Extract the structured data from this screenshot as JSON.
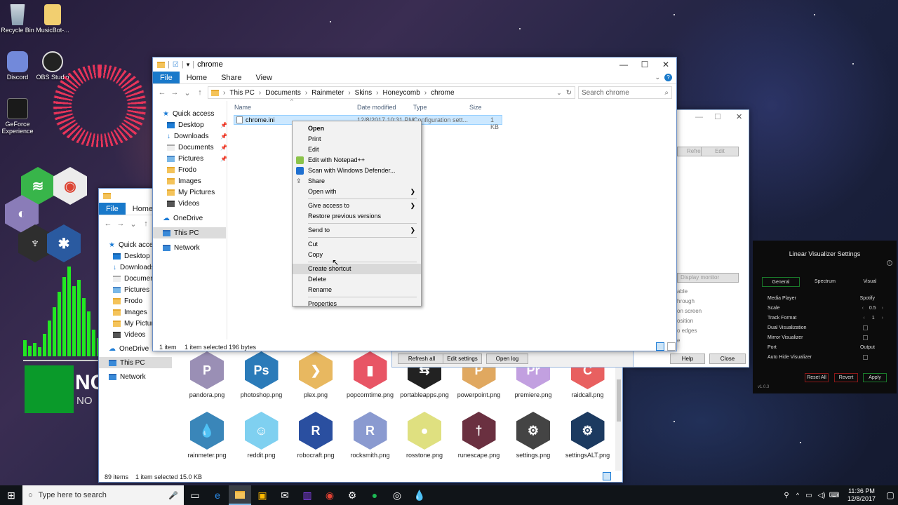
{
  "desktop": {
    "icons": [
      {
        "label": "Recycle Bin"
      },
      {
        "label": "MusicBot-..."
      },
      {
        "label": "Discord"
      },
      {
        "label": "OBS Studio"
      },
      {
        "label": "GeForce Experience"
      }
    ],
    "partial_text_large": "NO",
    "partial_text_small": "NO"
  },
  "explorer_front": {
    "title": "chrome",
    "tabs": [
      "File",
      "Home",
      "Share",
      "View"
    ],
    "breadcrumb": [
      "This PC",
      "Documents",
      "Rainmeter",
      "Skins",
      "Honeycomb",
      "chrome"
    ],
    "search_placeholder": "Search chrome",
    "nav": {
      "quick_access": "Quick access",
      "items": [
        "Desktop",
        "Downloads",
        "Documents",
        "Pictures",
        "Frodo",
        "Images",
        "My Pictures",
        "Videos"
      ],
      "onedrive": "OneDrive",
      "thispc": "This PC",
      "network": "Network"
    },
    "columns": [
      "Name",
      "Date modified",
      "Type",
      "Size"
    ],
    "file": {
      "name": "chrome.ini",
      "date": "12/8/2017 10:31 PM",
      "type": "Configuration sett...",
      "size": "1 KB"
    },
    "status": {
      "count": "1 item",
      "selected": "1 item selected  196 bytes"
    }
  },
  "context_menu": {
    "items": [
      "Open",
      "Print",
      "Edit",
      "Edit with Notepad++",
      "Scan with Windows Defender...",
      "Share",
      "Open with",
      "Give access to",
      "Restore previous versions",
      "Send to",
      "Cut",
      "Copy",
      "Create shortcut",
      "Delete",
      "Rename",
      "Properties"
    ]
  },
  "explorer_back": {
    "tabs": [
      "File",
      "Home"
    ],
    "nav": {
      "quick_access": "Quick access",
      "items": [
        "Desktop",
        "Downloads",
        "Documents",
        "Pictures",
        "Frodo",
        "Images",
        "My Pictures",
        "Videos"
      ],
      "onedrive": "OneDrive",
      "thispc": "This PC",
      "network": "Network"
    },
    "row1": [
      {
        "label": "pandora.png",
        "glyph": "P",
        "color": "#9a8fb5"
      },
      {
        "label": "photoshop.png",
        "glyph": "Ps",
        "color": "#2b7bb9"
      },
      {
        "label": "plex.png",
        "glyph": "❯",
        "color": "#e8b860"
      },
      {
        "label": "popcorntime.png",
        "glyph": "▮",
        "color": "#e85565"
      },
      {
        "label": "portableapps.png",
        "glyph": "⇆",
        "color": "#222222"
      },
      {
        "label": "powerpoint.png",
        "glyph": "P",
        "color": "#e0a860"
      },
      {
        "label": "premiere.png",
        "glyph": "Pr",
        "color": "#c2a0e0"
      },
      {
        "label": "raidcall.png",
        "glyph": "C",
        "color": "#e86060"
      }
    ],
    "row2": [
      {
        "label": "rainmeter.png",
        "glyph": "💧",
        "color": "#3a86b9"
      },
      {
        "label": "reddit.png",
        "glyph": "☺",
        "color": "#7fd0f0"
      },
      {
        "label": "robocraft.png",
        "glyph": "R",
        "color": "#2a4fa0"
      },
      {
        "label": "rocksmith.png",
        "glyph": "R",
        "color": "#8a9ad0"
      },
      {
        "label": "rosstone.png",
        "glyph": "●",
        "color": "#dfe080"
      },
      {
        "label": "runescape.png",
        "glyph": "†",
        "color": "#6a3040"
      },
      {
        "label": "settings.png",
        "glyph": "⚙",
        "color": "#444444"
      },
      {
        "label": "settingsALT.png",
        "glyph": "⚙",
        "color": "#1c3a60"
      }
    ],
    "status": {
      "count": "89 items",
      "selected": "1 item selected  15.0 KB"
    }
  },
  "rainmeter_manage": {
    "buttons_top": [
      "Refresh",
      "Edit"
    ],
    "dropdown": "Display monitor",
    "options": [
      "able",
      "hrough",
      "on screen",
      "osition",
      "o edges",
      "e"
    ],
    "bottom_buttons": [
      "Refresh all",
      "Edit settings",
      "Open log"
    ],
    "help": "Help",
    "close": "Close"
  },
  "visualizer": {
    "title": "Linear Visualizer Settings",
    "tabs": [
      "General",
      "Spectrum",
      "Visual"
    ],
    "rows": [
      {
        "label": "Media Player",
        "value": "Spotify"
      },
      {
        "label": "Scale",
        "value": "0.5"
      },
      {
        "label": "Track Format",
        "value": "1"
      },
      {
        "label": "Dual Visualization",
        "value": ""
      },
      {
        "label": "Mirror Visualizer",
        "value": ""
      },
      {
        "label": "Port",
        "value": "Output"
      },
      {
        "label": "Auto Hide Visualizer",
        "value": ""
      }
    ],
    "version": "v1.0.3",
    "buttons": [
      "Reset All",
      "Revert",
      "Apply"
    ],
    "accent": "#1a7a2a"
  },
  "taskbar": {
    "search_placeholder": "Type here to search",
    "time": "11:36 PM",
    "date": "12/8/2017"
  }
}
